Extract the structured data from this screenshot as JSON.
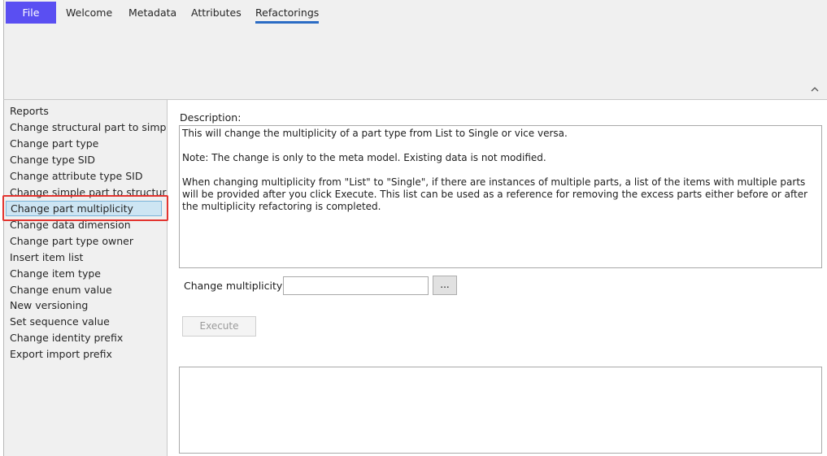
{
  "ribbon": {
    "tabs": [
      {
        "label": "File"
      },
      {
        "label": "Welcome"
      },
      {
        "label": "Metadata"
      },
      {
        "label": "Attributes"
      },
      {
        "label": "Refactorings"
      }
    ],
    "active_tab": "Refactorings",
    "file_tab_color": "#5a4ff2",
    "collapse_icon": "chevron-up-icon"
  },
  "refactorings": {
    "items": [
      "Reports",
      "Change structural part to simple",
      "Change part type",
      "Change type SID",
      "Change attribute type SID",
      "Change simple part to structural",
      "Change part multiplicity",
      "Change data dimension",
      "Change part type owner",
      "Insert item list",
      "Change item type",
      "Change enum value",
      "New versioning",
      "Set sequence value",
      "Change identity prefix",
      "Export import prefix"
    ],
    "selected": "Change part multiplicity"
  },
  "main": {
    "description_label": "Description:",
    "description_lines": [
      "This will change the multiplicity of a part type from List to Single or vice versa.",
      "Note: The change is only to the meta model. Existing data is not modified.",
      "When changing multiplicity from \"List\" to \"Single\", if there are instances of multiple parts, a list of the items with multiple parts will be provided after you click Execute. This list can be used as a reference for removing the excess parts either before or after the multiplicity refactoring is completed."
    ],
    "multiplicity_label": "Change multiplicity of",
    "multiplicity_value": "",
    "browse_label": "...",
    "execute_label": "Execute",
    "output_text": ""
  }
}
